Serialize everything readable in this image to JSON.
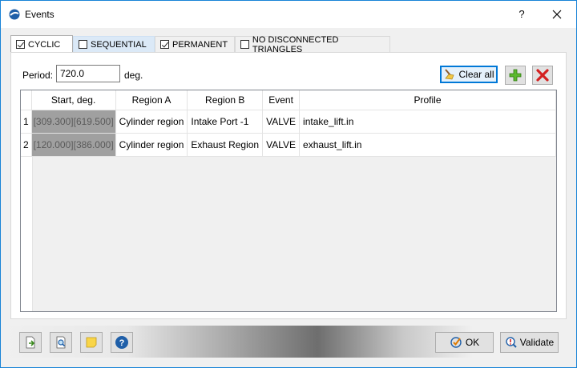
{
  "window": {
    "title": "Events",
    "help": "?"
  },
  "tabs": [
    {
      "label": "CYCLIC",
      "checked": true,
      "active": true
    },
    {
      "label": "SEQUENTIAL",
      "checked": false,
      "active": false
    },
    {
      "label": "PERMANENT",
      "checked": true,
      "active": false
    },
    {
      "label": "NO DISCONNECTED TRIANGLES",
      "checked": false,
      "active": false
    }
  ],
  "period": {
    "label": "Period:",
    "value": "720.0",
    "unit": "deg."
  },
  "toolbar": {
    "clear_label": "Clear all"
  },
  "table": {
    "columns": [
      "Start, deg.",
      "Region A",
      "Region B",
      "Event",
      "Profile"
    ],
    "rows": [
      {
        "num": "1",
        "start": "[309.300][619.500]",
        "region_a": "Cylinder region",
        "region_b": "Intake Port -1",
        "event": "VALVE",
        "profile": "intake_lift.in"
      },
      {
        "num": "2",
        "start": "[120.000][386.000]",
        "region_a": "Cylinder region",
        "region_b": "Exhaust Region",
        "event": "VALVE",
        "profile": "exhaust_lift.in"
      }
    ]
  },
  "footer": {
    "ok_label": "OK",
    "validate_label": "Validate"
  }
}
